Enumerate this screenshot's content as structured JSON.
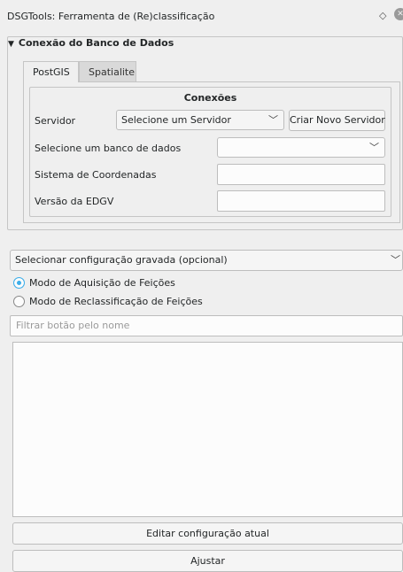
{
  "window": {
    "title": "DSGTools: Ferramenta de (Re)classificação",
    "float_icon": "◇",
    "close_icon": "✕"
  },
  "db_group": {
    "title": "Conexão do Banco de Dados",
    "tabs": [
      {
        "label": "PostGIS",
        "active": true
      },
      {
        "label": "Spatialite",
        "active": false
      }
    ],
    "connections_label": "Conexões",
    "server_label": "Servidor",
    "server_combo_value": "Selecione um Servidor",
    "new_server_button": "Criar Novo Servidor",
    "database_label": "Selecione um banco de dados",
    "database_combo_value": "",
    "crs_label": "Sistema de Coordenadas",
    "crs_value": "",
    "edgv_label": "Versão da EDGV",
    "edgv_value": ""
  },
  "config": {
    "saved_config_combo": "Selecionar configuração gravada (opcional)",
    "mode_acquisition": "Modo de Aquisição de Feições",
    "mode_reclassification": "Modo de Reclassificação de Feições",
    "selected_mode": "acquisition",
    "filter_placeholder": "Filtrar botão pelo nome"
  },
  "buttons": {
    "edit_config": "Editar configuração atual",
    "adjust": "Ajustar"
  },
  "colors": {
    "accent": "#3daee9",
    "background": "#efefef"
  }
}
